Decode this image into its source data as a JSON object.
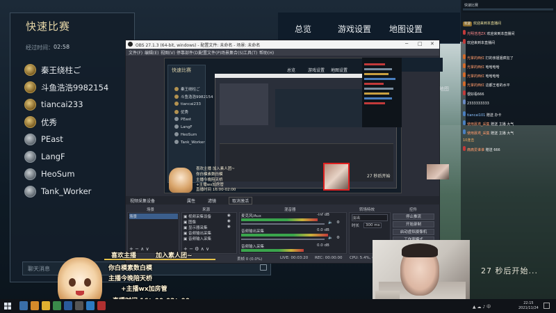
{
  "game": {
    "tabs": [
      "总览",
      "游戏设置",
      "地图设置"
    ],
    "panel_title": "快速比赛",
    "timer_label": "经过时间：",
    "timer_value": "02:58",
    "players": [
      "秦王绕柱ご",
      "斗鱼浩浩9982154",
      "tiancai233",
      "优秀",
      "PEast",
      "LangF",
      "HeoSum",
      "Tank_Worker"
    ],
    "chat_placeholder": "聊天消息",
    "countdown": "27 秒后开始...",
    "side_text": "地图"
  },
  "obs": {
    "title": "OBS 27.1.3 (64-bit, windows) - 配置文件: 未命名 - 场景: 未命名",
    "menu": [
      "文件(F)",
      "编辑(E)",
      "视图(V)",
      "停靠部件(D)",
      "配置文件(P)",
      "场景集合(S)",
      "工具(T)",
      "帮助(H)"
    ],
    "source_selected": "视频采集设备",
    "toolbar": [
      "属性",
      "滤镜",
      "取消激活"
    ],
    "docks": [
      "场景",
      "来源",
      "混音器",
      "转场特效",
      "控件"
    ],
    "scene_item": "场景",
    "sources": [
      "视频采集设备",
      "图像",
      "显示器采集",
      "音频输出采集",
      "音频输入采集"
    ],
    "mixer": [
      {
        "name": "麦克风/Aux",
        "value": "-inf dB"
      },
      {
        "name": "音频输出采集",
        "value": "0.0 dB"
      },
      {
        "name": "音频输入采集",
        "value": "0.0 dB"
      }
    ],
    "transition": "淡出",
    "duration_label": "时长",
    "duration_value": "300 ms",
    "controls": [
      "停止推流",
      "开始录制",
      "启动虚拟摄像机",
      "工作室模式"
    ],
    "status": [
      "丢帧 0 (0.0%)",
      "LIVE: 00:03:20",
      "REC: 00:00:00",
      "CPU: 5.4%, 60.00 fps"
    ],
    "preview": {
      "title": "快速比赛",
      "players": [
        "秦王绕柱ご",
        "斗鱼浩浩9982154",
        "tiancai233",
        "优秀",
        "PEast",
        "LangF",
        "HeoSum",
        "Tank_Worker"
      ],
      "tabs": [
        "总览",
        "游戏设置",
        "地图设置"
      ],
      "overlay": [
        "喜欢主播 加入素人团~",
        "你白模素数白模",
        "主播今晚陪天桥",
        "+主播wx加房管",
        "直播时间 16:00-02:00"
      ],
      "countdown": "27 秒后开始"
    }
  },
  "overlay": {
    "lines": [
      "喜欢主播",
      "加入素人团~",
      "你白模素数白模",
      "主播今晚陪天桥",
      "+主播wx加房管",
      "直播时间  16：00-02：00"
    ]
  },
  "livechat": {
    "header": "快速比赛",
    "messages": [
      {
        "badge": "欢迎",
        "user": "",
        "text": "欢迎来到本直播间"
      },
      {
        "badge": "",
        "user": "光明浩浩ZX",
        "text": "欢迎来到本直播间"
      },
      {
        "badge": "",
        "user": "",
        "text": "欢迎来到本直播间"
      },
      {
        "badge": "",
        "user": "光掌的西红",
        "text": "打的亲姐姐疯狂了"
      },
      {
        "badge": "",
        "user": "光掌的西红",
        "text": "哈哈哈哈"
      },
      {
        "badge": "",
        "user": "光掌的西红",
        "text": "哈哈哈哈"
      },
      {
        "badge": "",
        "user": "光掌的西红",
        "text": "这都王者的水平"
      },
      {
        "badge": "",
        "user": "",
        "text": "很好看666"
      },
      {
        "badge": "",
        "user": "",
        "text": "2333333333"
      },
      {
        "badge": "",
        "user": "tiancai101",
        "text": "赠送 办卡"
      },
      {
        "badge": "",
        "user": "使用晨鸢_采集",
        "text": "赠送 主播 大气"
      },
      {
        "badge": "",
        "user": "使用晨鸢_采集",
        "text": "赠送 主播 大气"
      },
      {
        "badge": "",
        "user": "",
        "text": "10连击"
      },
      {
        "badge": "",
        "user": "痛痛爱谁谁",
        "text": "赠送 666"
      }
    ]
  },
  "taskbar": {
    "time": "22:15",
    "date": "2021/11/24"
  },
  "colors": {
    "gold": "#e6d7a8",
    "live_red": "#e02020",
    "meter_green": "#3aa54c"
  }
}
